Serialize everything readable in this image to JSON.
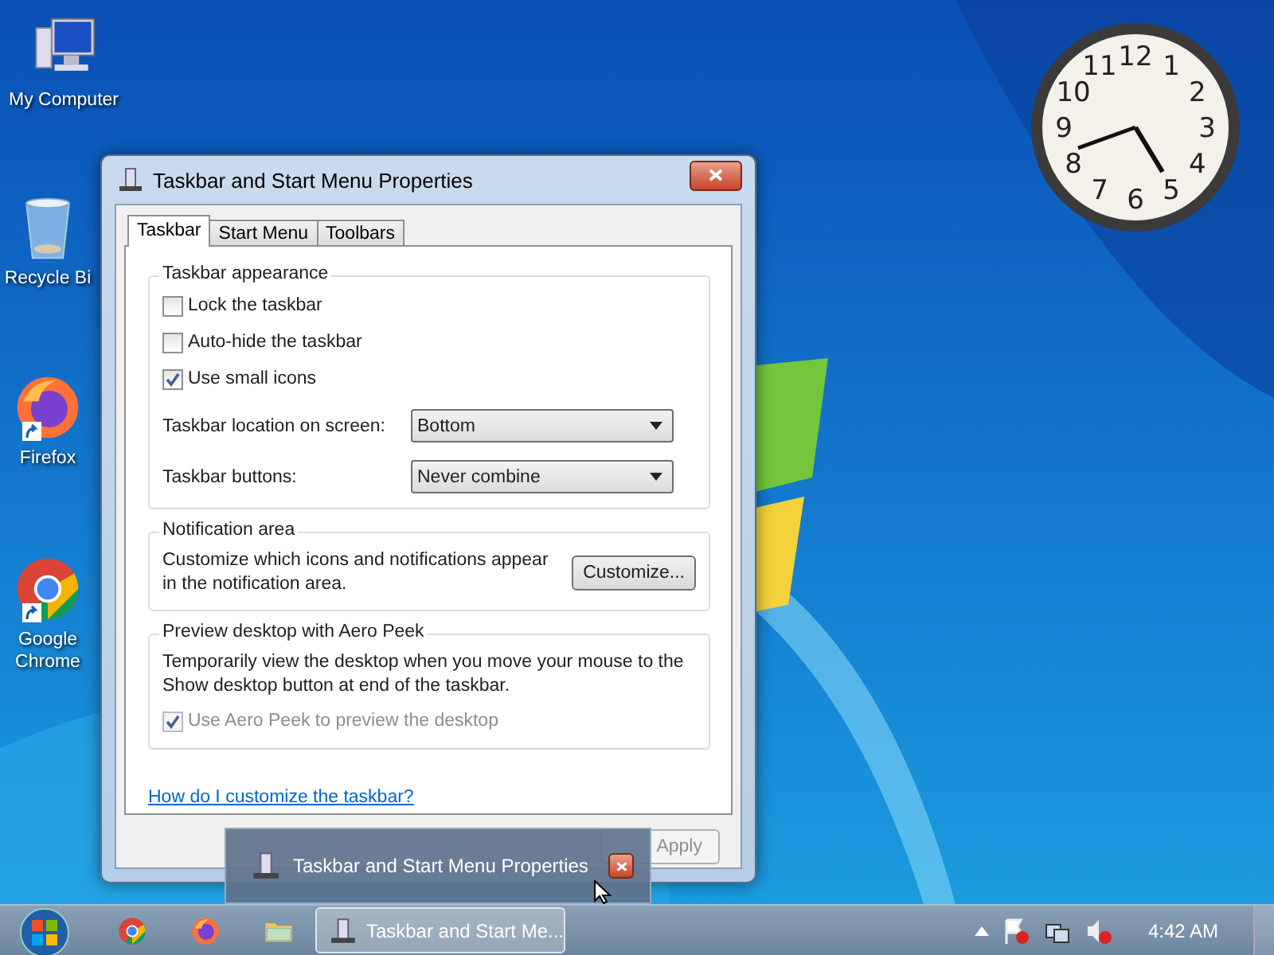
{
  "desktop_icons": [
    {
      "label": "My Computer",
      "kind": "computer"
    },
    {
      "label": "Recycle Bi",
      "kind": "recycle"
    },
    {
      "label": "Firefox",
      "kind": "firefox"
    },
    {
      "label": "Google Chrome",
      "kind": "chrome"
    }
  ],
  "clock_gadget": {
    "numerals": [
      "12",
      "11",
      "1",
      "10",
      "2",
      "9",
      "3",
      "8",
      "4",
      "7",
      "5",
      "6"
    ]
  },
  "window": {
    "title": "Taskbar and Start Menu Properties",
    "tabs": [
      {
        "label": "Taskbar",
        "selected": true
      },
      {
        "label": "Start Menu",
        "selected": false
      },
      {
        "label": "Toolbars",
        "selected": false
      }
    ],
    "appearance": {
      "title": "Taskbar appearance",
      "checkboxes": [
        {
          "label": "Lock the taskbar",
          "checked": false
        },
        {
          "label": "Auto-hide the taskbar",
          "checked": false
        },
        {
          "label": "Use small icons",
          "checked": true
        }
      ],
      "dropdowns": [
        {
          "label": "Taskbar location on screen:",
          "value": "Bottom"
        },
        {
          "label": "Taskbar buttons:",
          "value": "Never combine"
        }
      ]
    },
    "notification": {
      "title": "Notification area",
      "text": "Customize which icons and notifications appear in the notification area.",
      "button": "Customize..."
    },
    "aero_peek": {
      "title": "Preview desktop with Aero Peek",
      "text": "Temporarily view the desktop when you move your mouse to the Show desktop button at end of the taskbar.",
      "checkbox": {
        "label": "Use Aero Peek to preview the desktop",
        "checked": true,
        "disabled": true
      }
    },
    "help_link": "How do I customize the taskbar?",
    "buttons": [
      {
        "label": "Apply",
        "disabled": true
      }
    ]
  },
  "thumbnail": {
    "title": "Taskbar and Start Menu Properties"
  },
  "taskbar": {
    "pinned": [
      {
        "kind": "chrome"
      },
      {
        "kind": "firefox"
      },
      {
        "kind": "explorer"
      }
    ],
    "task": {
      "label": "Taskbar and Start Me...",
      "selected": true
    },
    "time": "4:42 AM"
  }
}
